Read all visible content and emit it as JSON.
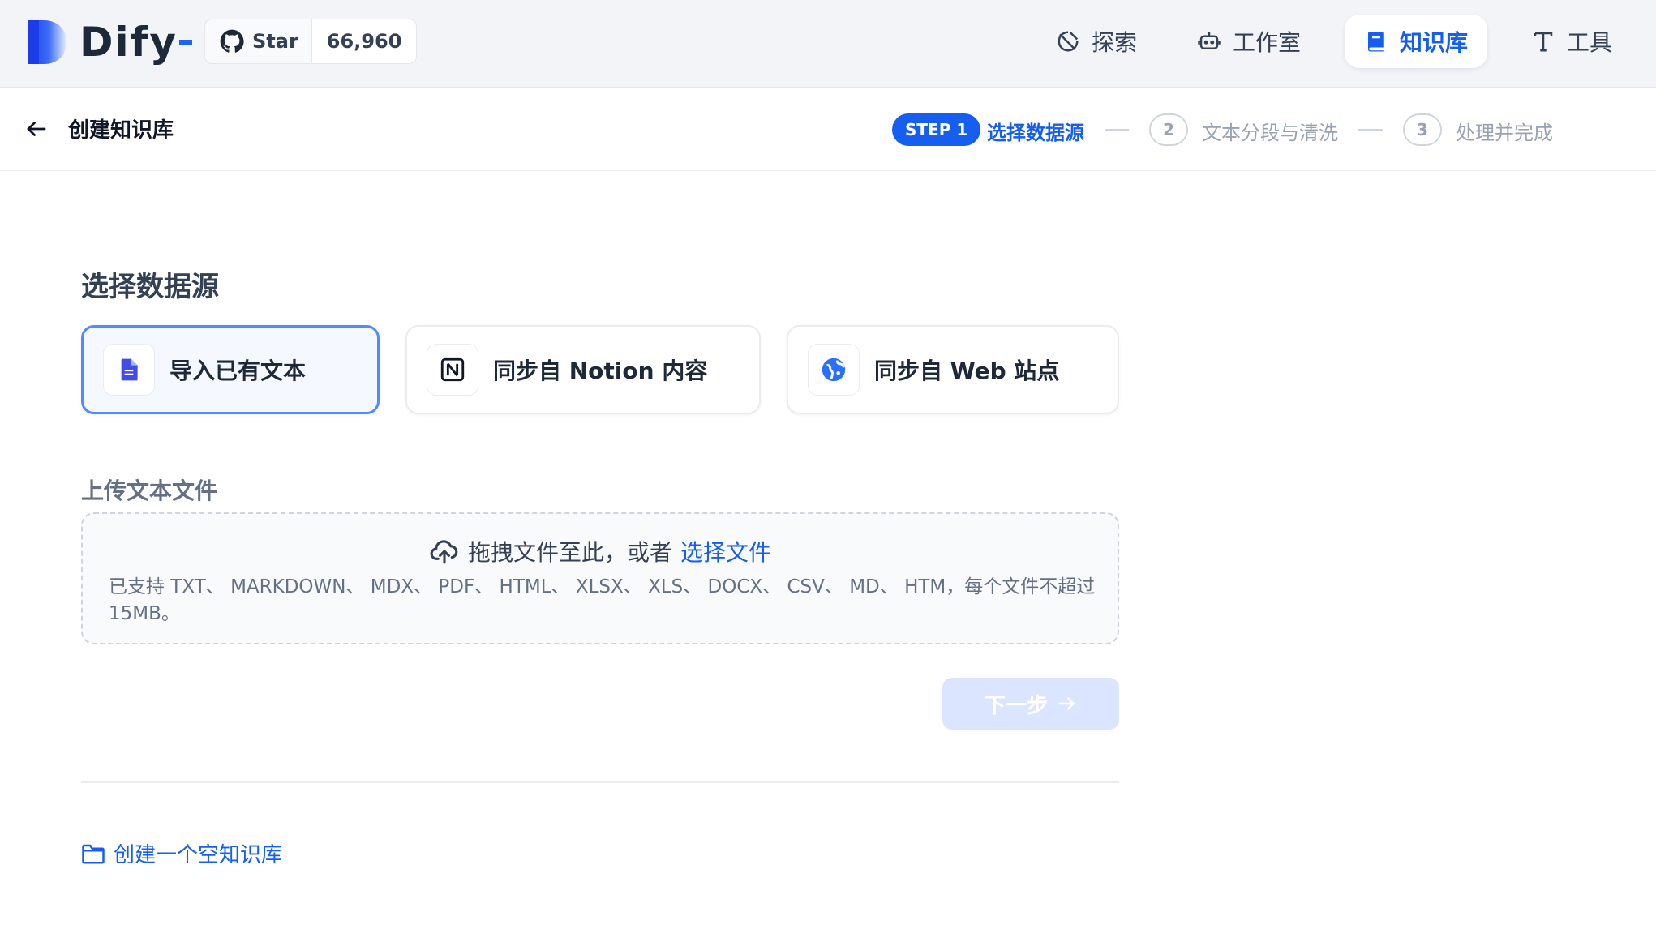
{
  "app": {
    "name": "Dify"
  },
  "github": {
    "star_label": "Star",
    "star_count": "66,960"
  },
  "nav": {
    "items": [
      {
        "label": "探索",
        "icon": "explore-icon"
      },
      {
        "label": "工作室",
        "icon": "robot-icon"
      },
      {
        "label": "知识库",
        "icon": "book-icon",
        "active": true
      },
      {
        "label": "工具",
        "icon": "tool-icon"
      }
    ]
  },
  "header": {
    "title": "创建知识库"
  },
  "steps": {
    "active_tag": "STEP 1",
    "items": [
      {
        "number": "1",
        "label": "选择数据源",
        "state": "active"
      },
      {
        "number": "2",
        "label": "文本分段与清洗",
        "state": "inactive"
      },
      {
        "number": "3",
        "label": "处理并完成",
        "state": "inactive"
      }
    ]
  },
  "main": {
    "section_title": "选择数据源",
    "sources": [
      {
        "label": "导入已有文本",
        "icon": "file-text-icon",
        "selected": true
      },
      {
        "label": "同步自 Notion 内容",
        "icon": "notion-icon",
        "selected": false
      },
      {
        "label": "同步自 Web 站点",
        "icon": "web-globe-icon",
        "selected": false
      }
    ],
    "upload": {
      "title": "上传文本文件",
      "drag_text": "拖拽文件至此，或者",
      "select_link": "选择文件",
      "supported": "已支持 TXT、 MARKDOWN、 MDX、 PDF、 HTML、 XLSX、 XLS、 DOCX、 CSV、 MD、 HTM，每个文件不超过 15MB。"
    },
    "next_button": "下一步",
    "create_empty": "创建一个空知识库"
  },
  "colors": {
    "accent": "#155eef",
    "topbar_bg": "#f2f4f7",
    "selected_border": "#528bff",
    "disabled_button": "#dbe5ff"
  }
}
